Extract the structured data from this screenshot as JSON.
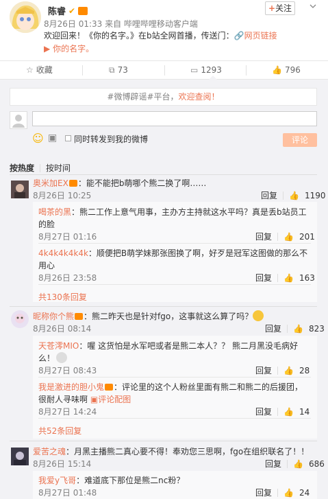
{
  "post": {
    "author": "陈睿",
    "meta": "8月26日 01:33 来自 哔哩哔哩移动客户端",
    "follow_label": "关注",
    "text_pre": "欢迎回来！《你的名字。》在b站全网首播，传送门：",
    "link1": "网页链接",
    "link2": "你的名字。"
  },
  "actions": {
    "collect": "收藏",
    "repost": "73",
    "comment": "1293",
    "like": "796"
  },
  "notice": {
    "pre": "#微博辟谣#平台，",
    "link": "欢迎查阅！"
  },
  "composer": {
    "repost_label": "同时转发到我的微博",
    "submit_label": "评论"
  },
  "sort": {
    "hot": "按热度",
    "time": "按时间"
  },
  "comments": [
    {
      "name": "奥米加EX",
      "text": "：能不能把b萌哪个熊二换了啊……",
      "time": "8月26日 10:25",
      "reply": "回复",
      "likes": "1190",
      "replies": [
        {
          "name": "喝茶的黑",
          "text": "：熊二工作上意气用事，主办方主持就这水平吗？真是丢b站员工的脸",
          "time": "8月27日 01:16",
          "reply": "回复",
          "likes": "201"
        },
        {
          "name": "4k4k4k4k4k",
          "text": "：顺便把B萌学妹那张图换了啊，好歹是冠军这图做的那么不用心",
          "time": "8月26日 23:58",
          "reply": "回复",
          "likes": "163"
        }
      ],
      "more": "共130条回复"
    },
    {
      "name": "昵称你个熊",
      "text": "：熊二昨天也是针对fgo，这事就这么算了吗？",
      "time": "8月26日 08:14",
      "reply": "回复",
      "likes": "823",
      "replies": [
        {
          "name": "天苍澪MIO",
          "text": "：喔  这货怕是水军吧或者是熊二本人？？  熊二月黑没毛病好么！",
          "time": "8月27日 08:43",
          "reply": "回复",
          "likes": "28"
        },
        {
          "name": "我是激进的胆小鬼",
          "text": "：评论里的这个人粉丝里面有熊二和熊二的后援团，很耐人寻味啊",
          "pic": "评论配图",
          "time": "8月27日 14:24",
          "reply": "回复",
          "likes": "14"
        }
      ],
      "more": "共52条回复"
    },
    {
      "name": "爱苦之魂",
      "text": "：月黑主播熊二真心要不得！奉劝您三思啊，fgo在组织联名了！！",
      "time": "8月26日 15:14",
      "reply": "回复",
      "likes": "686",
      "replies": [
        {
          "name": "我爱y飞哥",
          "text": "：难道底下那位是熊二nc粉？",
          "time": "8月27日 01:48",
          "reply": "回复",
          "likes": "24"
        }
      ]
    }
  ],
  "colors": {
    "accent": "#eb7350",
    "panel_bg": "#f2f2f5",
    "submit_bg": "#ffc09f"
  }
}
